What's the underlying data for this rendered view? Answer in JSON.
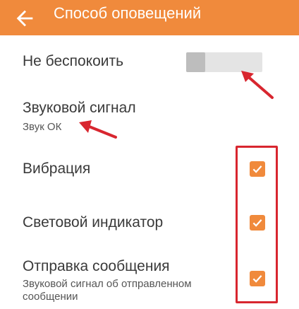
{
  "app_bar": {
    "title": "Способ оповещений",
    "back_icon": "arrow-back-icon",
    "background": "#f08a3c"
  },
  "settings": {
    "do_not_disturb": {
      "label": "Не беспокоить",
      "enabled": false
    },
    "sound": {
      "label": "Звуковой сигнал",
      "value": "Звук ОК"
    },
    "vibration": {
      "label": "Вибрация",
      "checked": true
    },
    "led": {
      "label": "Световой индикатор",
      "checked": true
    },
    "send_message": {
      "label": "Отправка сообщения",
      "description": "Звуковой сигнал об отправленном сообщении",
      "checked": true
    }
  },
  "colors": {
    "accent": "#f08a3c",
    "annotation": "#d8262f"
  }
}
